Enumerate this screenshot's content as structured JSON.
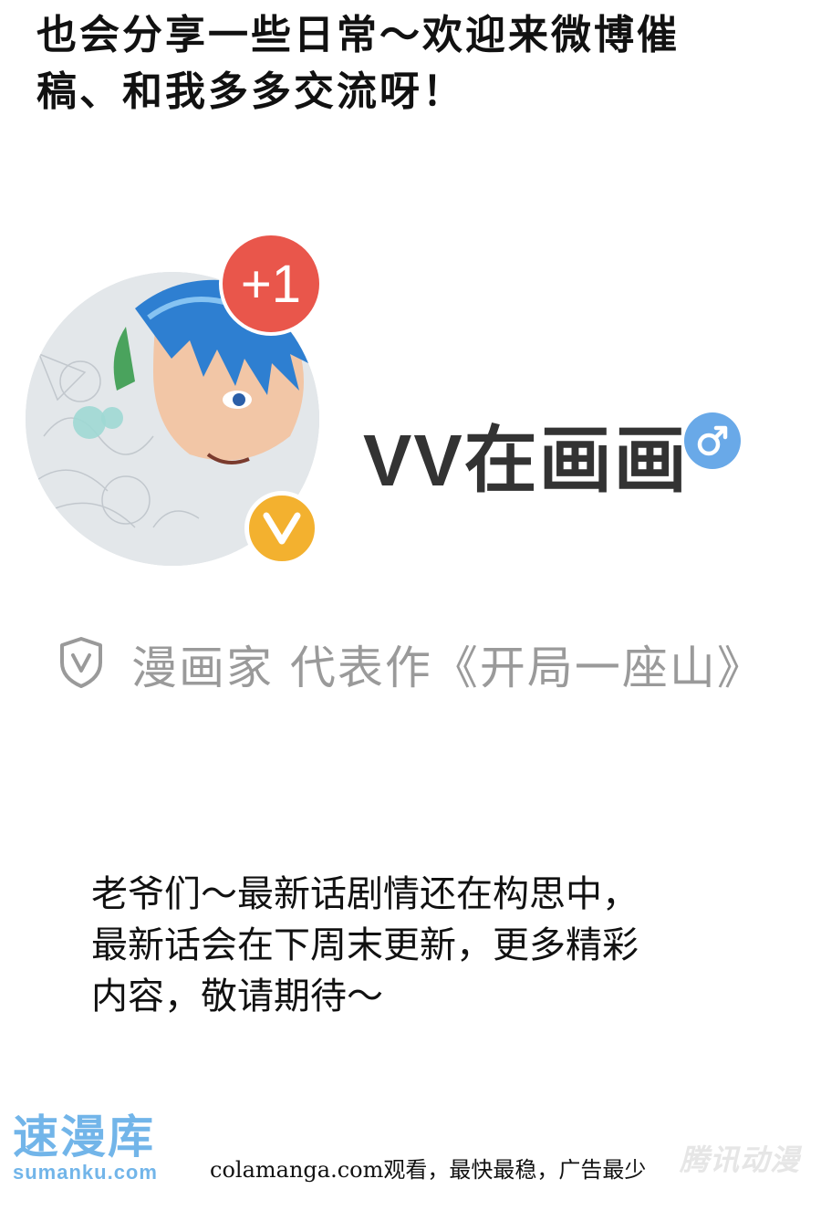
{
  "intro": {
    "line1": "也会分享一些日常～欢迎来微博催",
    "line2": "稿、和我多多交流呀！"
  },
  "profile": {
    "badge_count": "+1",
    "verified_letter": "V",
    "name": "VV在画画",
    "gender_symbol": "♂",
    "verify_icon_letter": "V",
    "verify_text": "漫画家 代表作《开局一座山》"
  },
  "notice": {
    "line1": "老爷们～最新话剧情还在构思中，",
    "line2": "最新话会在下周末更新，更多精彩",
    "line3": "内容，敬请期待～"
  },
  "watermarks": {
    "left_cn": "速漫库",
    "left_en": "sumanku.com",
    "right": "腾讯动漫"
  },
  "footer": "colamanga.com观看，最快最稳，广告最少",
  "colors": {
    "badge_red": "#e9564b",
    "verified_gold": "#f3b12f",
    "gender_blue": "#69a9e8",
    "watermark_blue": "#5aa9e6"
  }
}
